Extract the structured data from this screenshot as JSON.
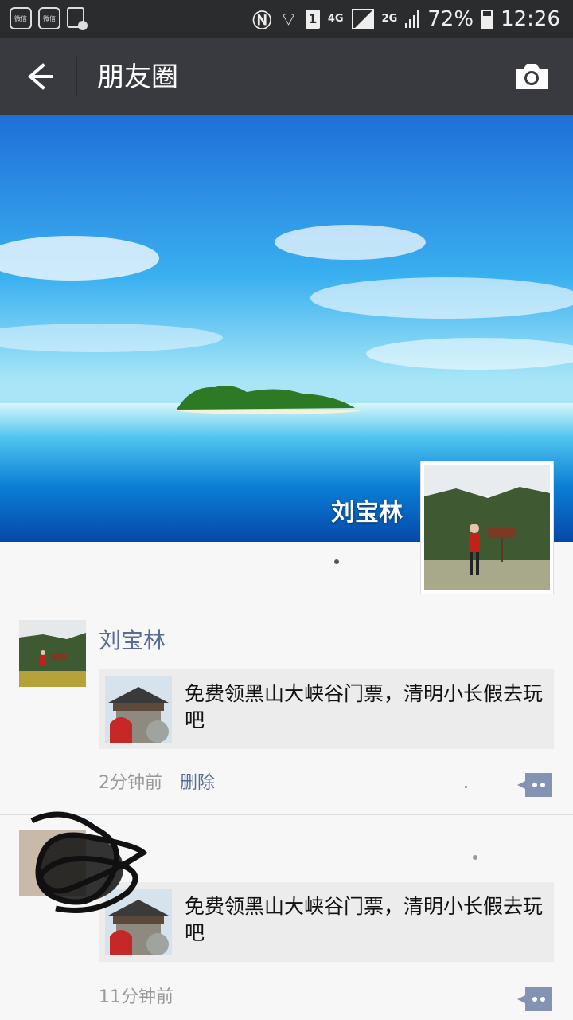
{
  "status_bar": {
    "app_icon_1": "微信",
    "app_icon_2": "微信",
    "network_4g": "4G",
    "network_2g": "2G",
    "sim_label": "1",
    "battery": "72%",
    "time": "12:26"
  },
  "header": {
    "title": "朋友圈"
  },
  "cover": {
    "username": "刘宝林"
  },
  "posts": [
    {
      "author": "刘宝林",
      "share_text": "免费领黑山大峡谷门票，清明小长假去玩吧",
      "time": "2分钟前",
      "delete_label": "删除"
    },
    {
      "author": "",
      "share_text": "免费领黑山大峡谷门票，清明小长假去玩吧",
      "time": "11分钟前"
    }
  ]
}
